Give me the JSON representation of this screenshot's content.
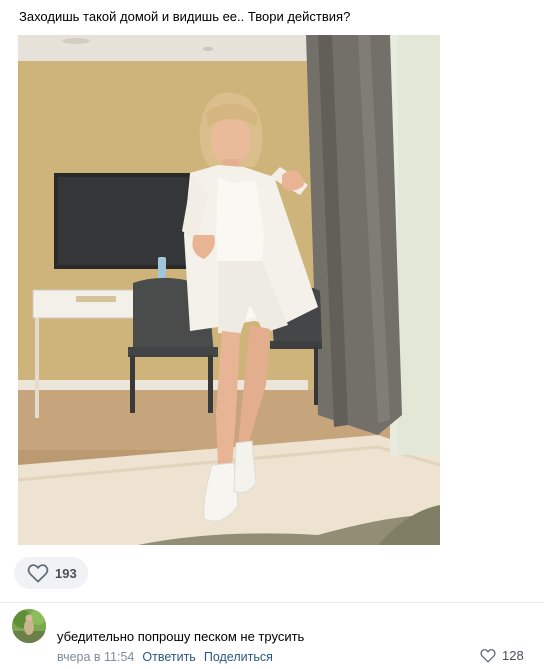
{
  "post": {
    "text": "Заходишь такой домой и видишь ее.. Твори действия?",
    "likes": "193"
  },
  "comment": {
    "text": "убедительно попрошу песком не трусить",
    "time": "вчера в 11:54",
    "reply_label": "Ответить",
    "share_label": "Поделиться",
    "likes": "128"
  },
  "icons": {
    "post_like": "heart-outline-icon",
    "comment_like": "heart-outline-icon"
  },
  "colors": {
    "link": "#2a5885",
    "meta": "#818c99",
    "pill_bg": "#f0f2f5"
  }
}
